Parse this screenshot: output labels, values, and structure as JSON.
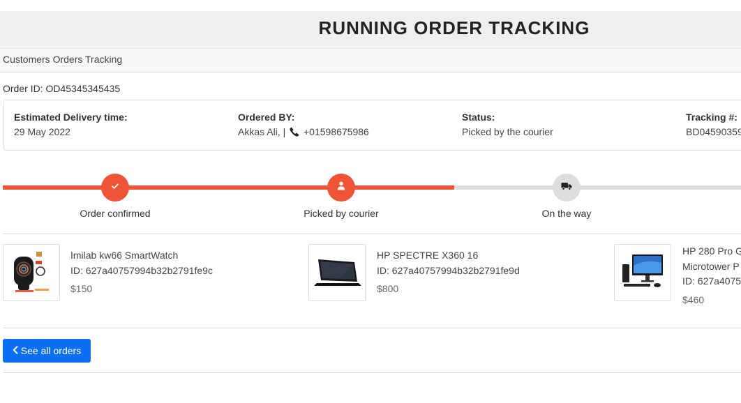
{
  "page": {
    "title": "RUNNING ORDER TRACKING",
    "card_header": "Customers Orders Tracking"
  },
  "order": {
    "id_text": "Order ID: OD45345345435",
    "estimated_label": "Estimated Delivery time:",
    "estimated_value": "29 May 2022",
    "ordered_by_label": "Ordered BY:",
    "ordered_by_name": "Akkas Ali, |",
    "ordered_by_phone": "+01598675986",
    "status_label": "Status:",
    "status_value": "Picked by the courier",
    "tracking_label": "Tracking #:",
    "tracking_value": "BD04590359"
  },
  "steps": [
    {
      "label": "Order confirmed",
      "icon": "check-icon",
      "completed": true
    },
    {
      "label": "Picked by courier",
      "icon": "user-icon",
      "completed": true
    },
    {
      "label": "On the way",
      "icon": "truck-icon",
      "completed": false
    }
  ],
  "progress": {
    "filled_fraction": 0.61
  },
  "products": [
    {
      "name": "Imilab kw66 SmartWatch",
      "id": "ID: 627a40757994b32b2791fe9c",
      "price": "$150",
      "image": "smartwatch-image"
    },
    {
      "name": "HP SPECTRE X360 16",
      "id": "ID: 627a40757994b32b2791fe9d",
      "price": "$800",
      "image": "laptop-image"
    },
    {
      "name_line1": "HP 280 Pro G",
      "name_line2": "Microtower P",
      "id": "ID: 627a4075",
      "price": "$460",
      "image": "desktop-image"
    }
  ],
  "actions": {
    "see_all_label": "See all orders",
    "see_all_icon": "chevron-left-icon"
  },
  "colors": {
    "accent": "#ee5435",
    "primary_button": "#0b6ff2",
    "inactive": "#dddddd"
  }
}
